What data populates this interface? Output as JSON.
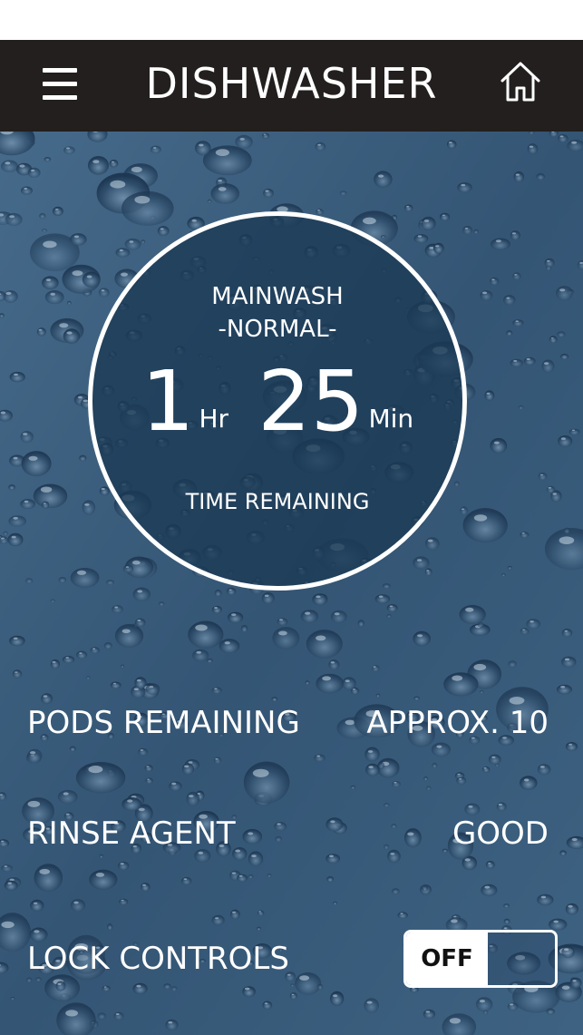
{
  "header": {
    "title": "DISHWASHER",
    "menu_icon": "hamburger-menu-icon",
    "home_icon": "home-icon"
  },
  "status": {
    "cycle": "MAINWASH",
    "option": "-NORMAL-",
    "hours": "1",
    "hours_unit": "Hr",
    "minutes": "25",
    "minutes_unit": "Min",
    "time_label": "TIME REMAINING"
  },
  "info": {
    "pods_label": "PODS REMAINING",
    "pods_value": "APPROX. 10",
    "rinse_label": "RINSE AGENT",
    "rinse_value": "GOOD",
    "lock_label": "LOCK CONTROLS",
    "lock_state": "OFF"
  },
  "colors": {
    "header_bg": "#231f1e",
    "background": "#3b5a78",
    "text": "#ffffff"
  }
}
